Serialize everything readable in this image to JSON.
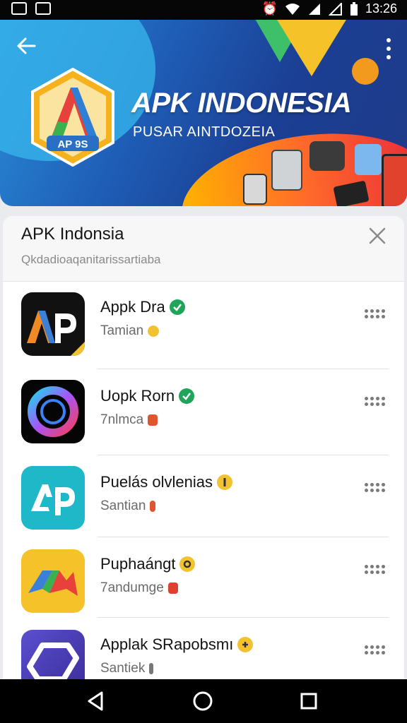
{
  "status_bar": {
    "time": "13:26"
  },
  "hero": {
    "title": "APK INDONESIA",
    "subtitle": "PUSAR AINTDOZEIA",
    "logo_text": "AP 9S",
    "colors": {
      "accent_blue": "#1f5fb8",
      "accent_orange": "#ff8a1e"
    }
  },
  "card": {
    "title": "APK Indonsia",
    "search_placeholder": "Qkdadioaqanitarissartiaba"
  },
  "apps": [
    {
      "name": "Appk Dra",
      "subtitle": "Tamian",
      "icon": "ap-logo-icon",
      "badge_color": "#1fa55a",
      "chip_color": "#f2c230"
    },
    {
      "name": "Uopk Rorn",
      "subtitle": "7nlmca",
      "icon": "ring-logo-icon",
      "badge_color": "#1fa55a",
      "chip_color": "#e0552f"
    },
    {
      "name": "Puelás olvlenias",
      "subtitle": "Santian",
      "icon": "ap-teal-logo-icon",
      "badge_color": "#f2c230",
      "chip_color": "#e0552f"
    },
    {
      "name": "Puphaángt",
      "subtitle": "7andumge",
      "icon": "arrow-logo-icon",
      "badge_color": "#f2c230",
      "chip_color": "#e0402f"
    },
    {
      "name": "Applak SRapobsmı",
      "subtitle": "Santiek",
      "icon": "frame-logo-icon",
      "badge_color": "#f2c230",
      "chip_color": "#777777"
    }
  ]
}
